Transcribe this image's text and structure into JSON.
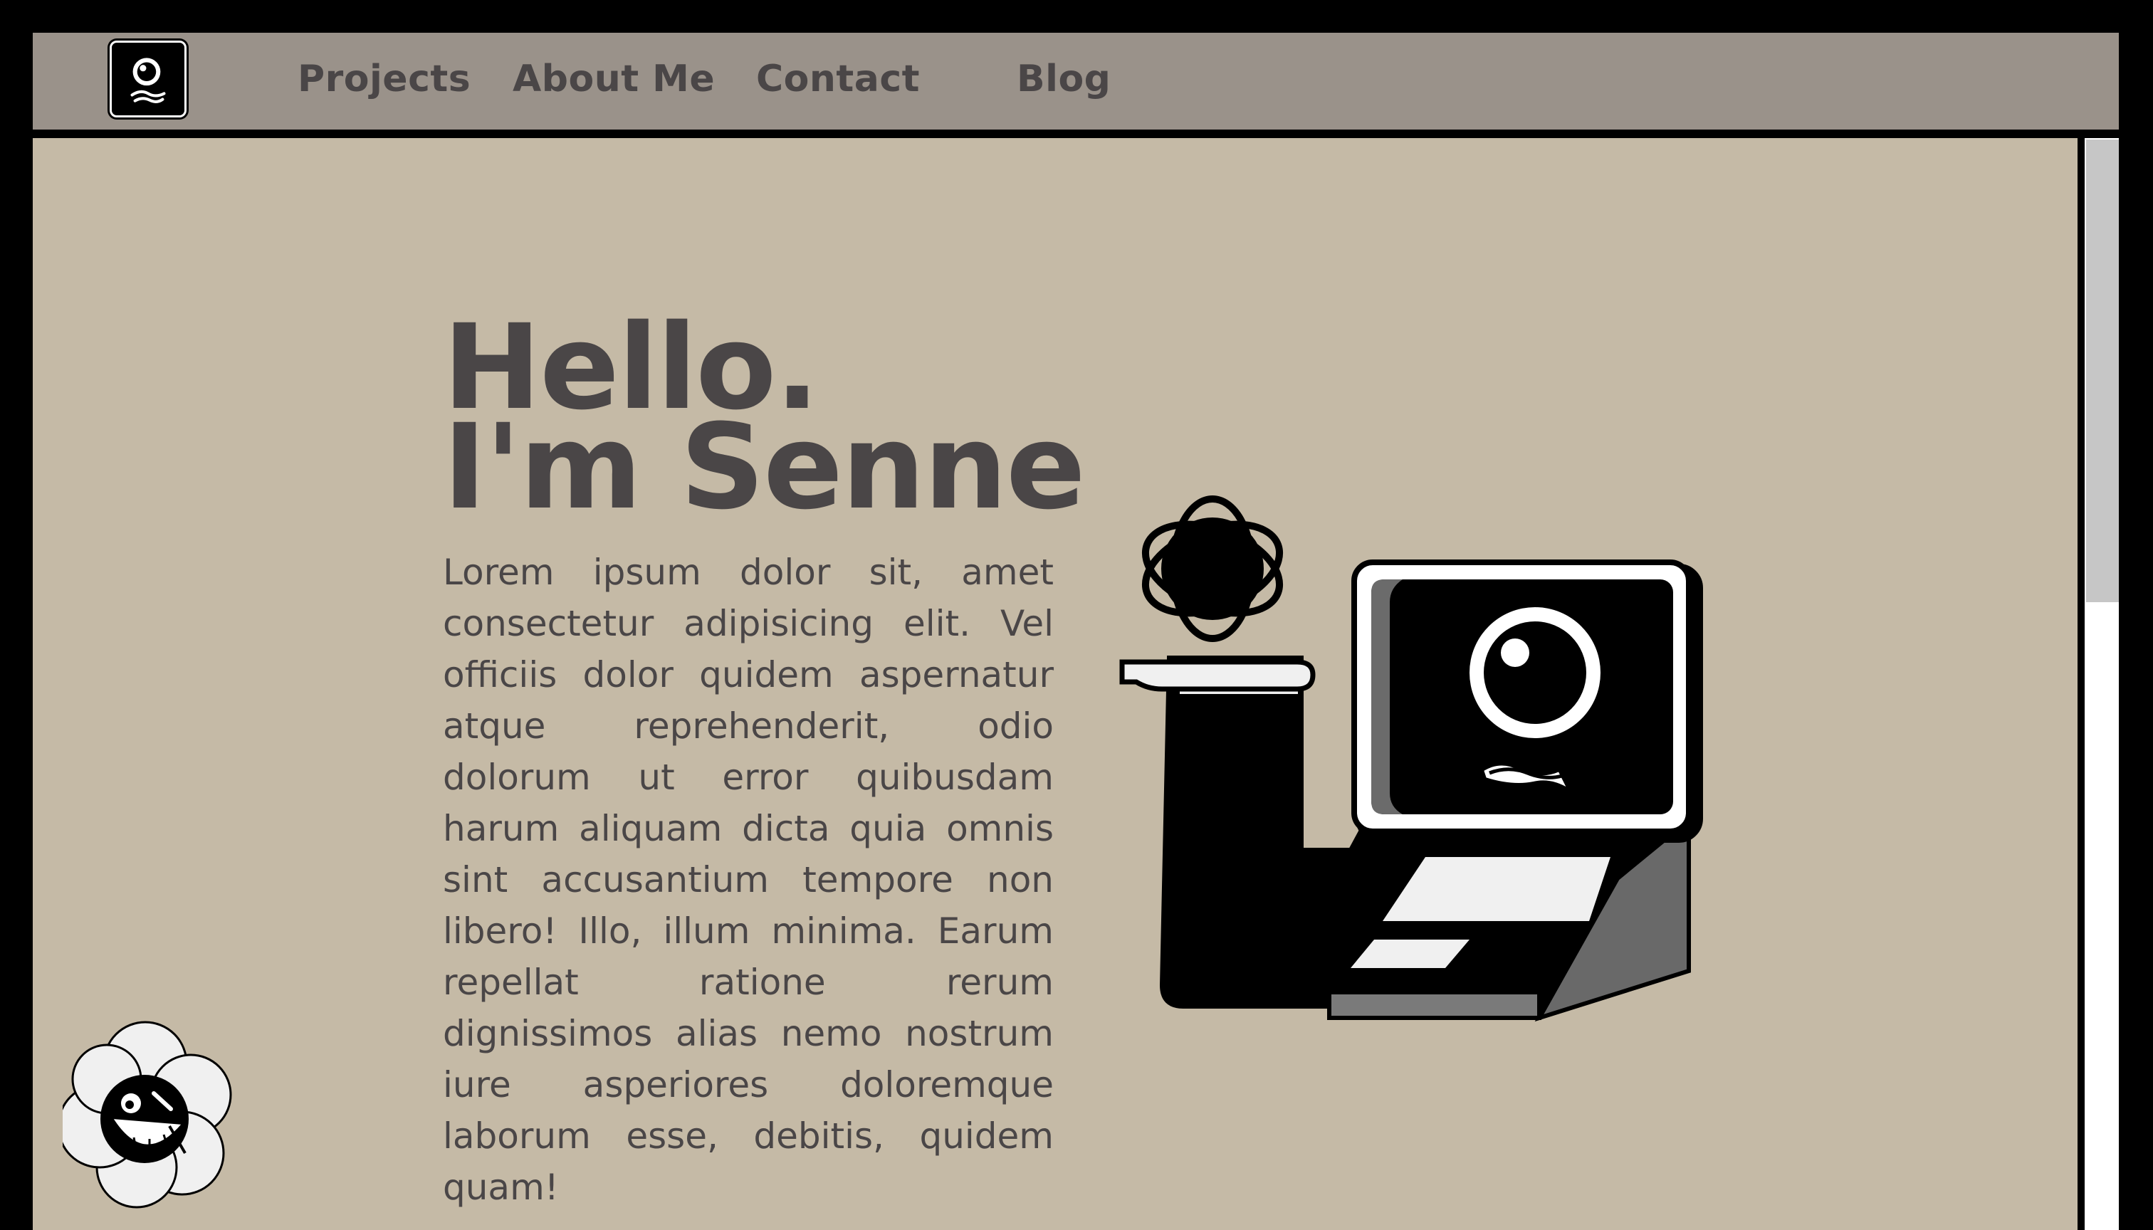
{
  "nav": {
    "logo_alt": "Senne logo",
    "links": [
      {
        "label": "Projects"
      },
      {
        "label": "About Me"
      },
      {
        "label": "Contact"
      },
      {
        "label": "Blog"
      }
    ]
  },
  "hero": {
    "title_line1": "Hello.",
    "title_line2": "I'm Senne",
    "paragraph": "Lorem ipsum dolor sit, amet consectetur adipisicing elit. Vel officiis dolor quidem aspernatur atque reprehenderit, odio dolorum ut error quibusdam harum aliquam dicta quia omnis sint accusantium tempore non libero! Illo, illum minima. Earum repellat ratione rerum dignissimos alias nemo nostrum iure asperiores doloremque laborum esse, debitis, quidem quam!"
  },
  "colors": {
    "page_frame": "#000000",
    "navbar_bg": "#9a928a",
    "content_bg": "#c5baa6",
    "text": "#4a4647",
    "scrollbar_thumb": "#c6c6c6",
    "scrollbar_track": "#ffffff"
  },
  "icons": {
    "logo": "eye-face-icon",
    "atom": "atom-icon",
    "computer": "computer-character-icon",
    "flower": "flower-face-icon"
  }
}
